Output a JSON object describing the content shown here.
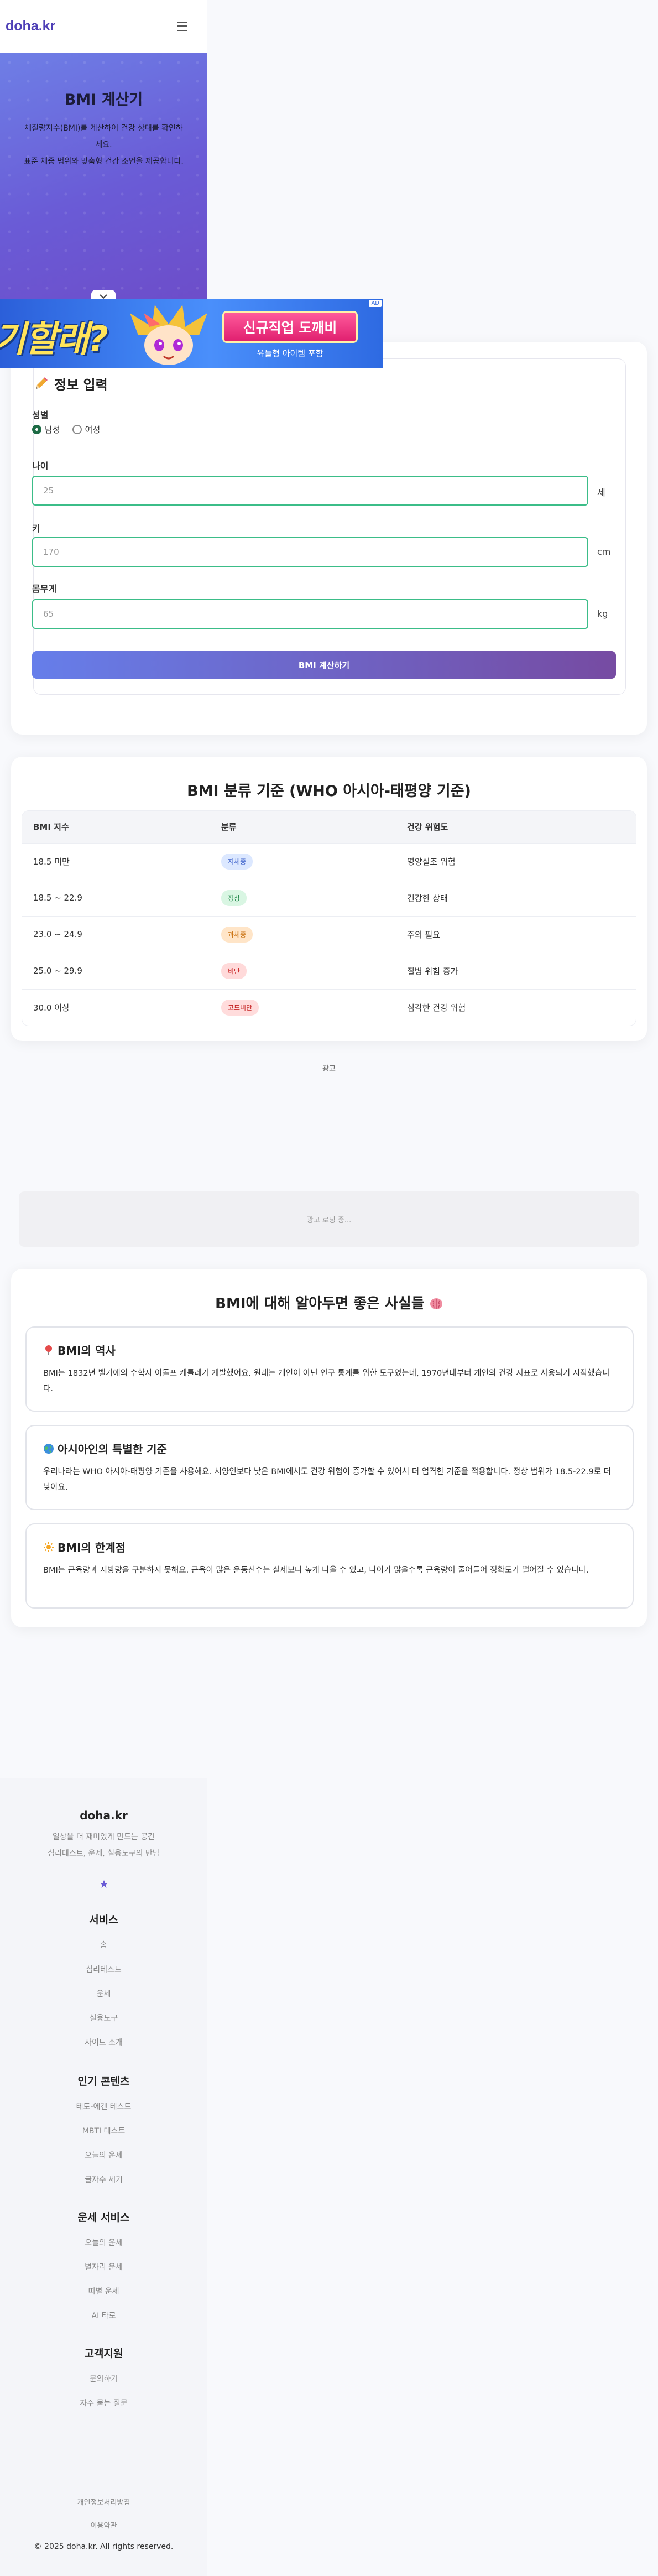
{
  "header": {
    "logo": "doha.kr"
  },
  "hero": {
    "title": "BMI 계산기",
    "line1": "체질량지수(BMI)를 계산하여 건강 상태를 확인하",
    "line2": "세요.",
    "line3": "표준 체중 범위와 맞춤형 건강 조언을 제공합니다."
  },
  "ad_banner": {
    "big_text": "기할래?",
    "button": "신규직업 도깨비",
    "sub": "육들형 아이템 포함",
    "badge": "AD"
  },
  "form": {
    "title": "정보 입력",
    "gender_label": "성별",
    "male": "남성",
    "female": "여성",
    "age_label": "나이",
    "age_placeholder": "25",
    "age_unit": "세",
    "height_label": "키",
    "height_placeholder": "170",
    "height_unit": "cm",
    "weight_label": "몸무게",
    "weight_placeholder": "65",
    "weight_unit": "kg",
    "submit": "BMI 계산하기"
  },
  "bmi_table": {
    "title": "BMI 분류 기준 (WHO 아시아-태평양 기준)",
    "headers": [
      "BMI 지수",
      "분류",
      "건강 위험도"
    ],
    "rows": [
      {
        "range": "18.5 미만",
        "class": "저체중",
        "risk": "영양실조 위험"
      },
      {
        "range": "18.5 ~ 22.9",
        "class": "정상",
        "risk": "건강한 상태"
      },
      {
        "range": "23.0 ~ 24.9",
        "class": "과체중",
        "risk": "주의 필요"
      },
      {
        "range": "25.0 ~ 29.9",
        "class": "비만",
        "risk": "질병 위험 증가"
      },
      {
        "range": "30.0 이상",
        "class": "고도비만",
        "risk": "심각한 건강 위험"
      }
    ]
  },
  "ad": {
    "label": "광고",
    "loading": "광고 로딩 중..."
  },
  "facts": {
    "title": "BMI에 대해 알아두면 좋은 사실들",
    "items": [
      {
        "title": "BMI의 역사",
        "text": "BMI는 1832년 벨기에의 수학자 아돌프 케틀레가 개발했어요. 원래는 개인이 아닌 인구 통계를 위한 도구였는데, 1970년대부터 개인의 건강 지표로 사용되기 시작했습니다."
      },
      {
        "title": "아시아인의 특별한 기준",
        "text": "우리나라는 WHO 아시아-태평양 기준을 사용해요. 서양인보다 낮은 BMI에서도 건강 위험이 증가할 수 있어서 더 엄격한 기준을 적용합니다. 정상 범위가 18.5-22.9로 더 낮아요."
      },
      {
        "title": "BMI의 한계점",
        "text": "BMI는 근육량과 지방량을 구분하지 못해요. 근육이 많은 운동선수는 실제보다 높게 나올 수 있고, 나이가 많을수록 근육량이 줄어들어 정확도가 떨어질 수 있습니다."
      }
    ]
  },
  "footer": {
    "logo": "doha.kr",
    "desc1": "일상을 더 재미있게 만드는 공간",
    "desc2": "심리테스트, 운세, 실용도구의 만남",
    "services": {
      "title": "서비스",
      "links": [
        "홈",
        "심리테스트",
        "운세",
        "실용도구",
        "사이트 소개"
      ]
    },
    "popular": {
      "title": "인기 콘텐츠",
      "links": [
        "테토-에겐 테스트",
        "MBTI 테스트",
        "오늘의 운세",
        "글자수 세기"
      ]
    },
    "fortune": {
      "title": "운세 서비스",
      "links": [
        "오늘의 운세",
        "별자리 운세",
        "띠별 운세",
        "AI 타로"
      ]
    },
    "support": {
      "title": "고객지원",
      "links": [
        "문의하기",
        "자주 묻는 질문"
      ]
    },
    "bottom_links": [
      "개인정보처리방침",
      "이용약관"
    ],
    "copyright": "© 2025 doha.kr. All rights reserved."
  }
}
